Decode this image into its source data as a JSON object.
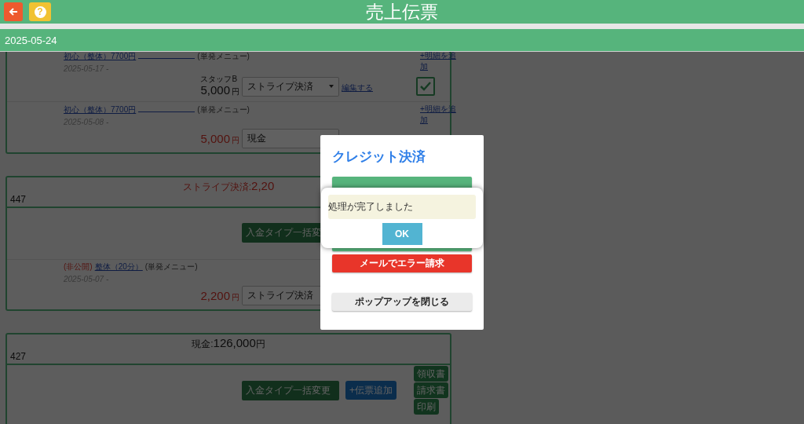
{
  "header": {
    "title": "売上伝票",
    "help_glyph": "?"
  },
  "date": "2025-05-24",
  "cards": [
    {
      "items": [
        {
          "menu": "初心（整体）7700円",
          "menu_type": "(単発メニュー)",
          "date": "2025-05-17 -",
          "add_detail": "+明細を追加",
          "staff": "スタッフB",
          "price": "5,000",
          "unit": "円",
          "price_warning": false,
          "payment": "ストライプ決済",
          "edit": "編集する",
          "checked": true
        },
        {
          "menu": "初心（整体）7700円",
          "menu_type": "(単発メニュー)",
          "date": "2025-05-08 -",
          "add_detail": "+明細を追加",
          "price": "5,000",
          "unit": "円",
          "price_warning": true,
          "payment": "現金"
        }
      ]
    },
    {
      "summary_label": "ストライプ決済:",
      "summary_amount": "2,20",
      "summary_warning": true,
      "number": "447",
      "bulk": "入金タイプ一括変",
      "items": [
        {
          "private": "(非公開)",
          "menu": "整体（20分）",
          "menu_type": "(単発メニュー)",
          "date": "2025-05-07 -",
          "price": "2,200",
          "unit": "円",
          "price_warning": true,
          "payment": "ストライプ決済"
        }
      ]
    },
    {
      "summary_label": "現金:",
      "summary_amount": "126,000",
      "summary_unit": "円",
      "summary_warning": false,
      "number": "427",
      "bulk": "入金タイプ一括変更",
      "add_slip": "+伝票追加",
      "docs": [
        "領収書",
        "請求書",
        "印刷"
      ]
    }
  ],
  "modal": {
    "title": "クレジット決済",
    "buttons": [
      {
        "kind": "success"
      },
      {
        "kind": "success"
      },
      {
        "label": "メールでエラー請求",
        "kind": "danger"
      },
      {
        "label": "ポップアップを閉じる",
        "kind": "default"
      }
    ]
  },
  "alert": {
    "message": "処理が完了しました",
    "button": "OK"
  }
}
